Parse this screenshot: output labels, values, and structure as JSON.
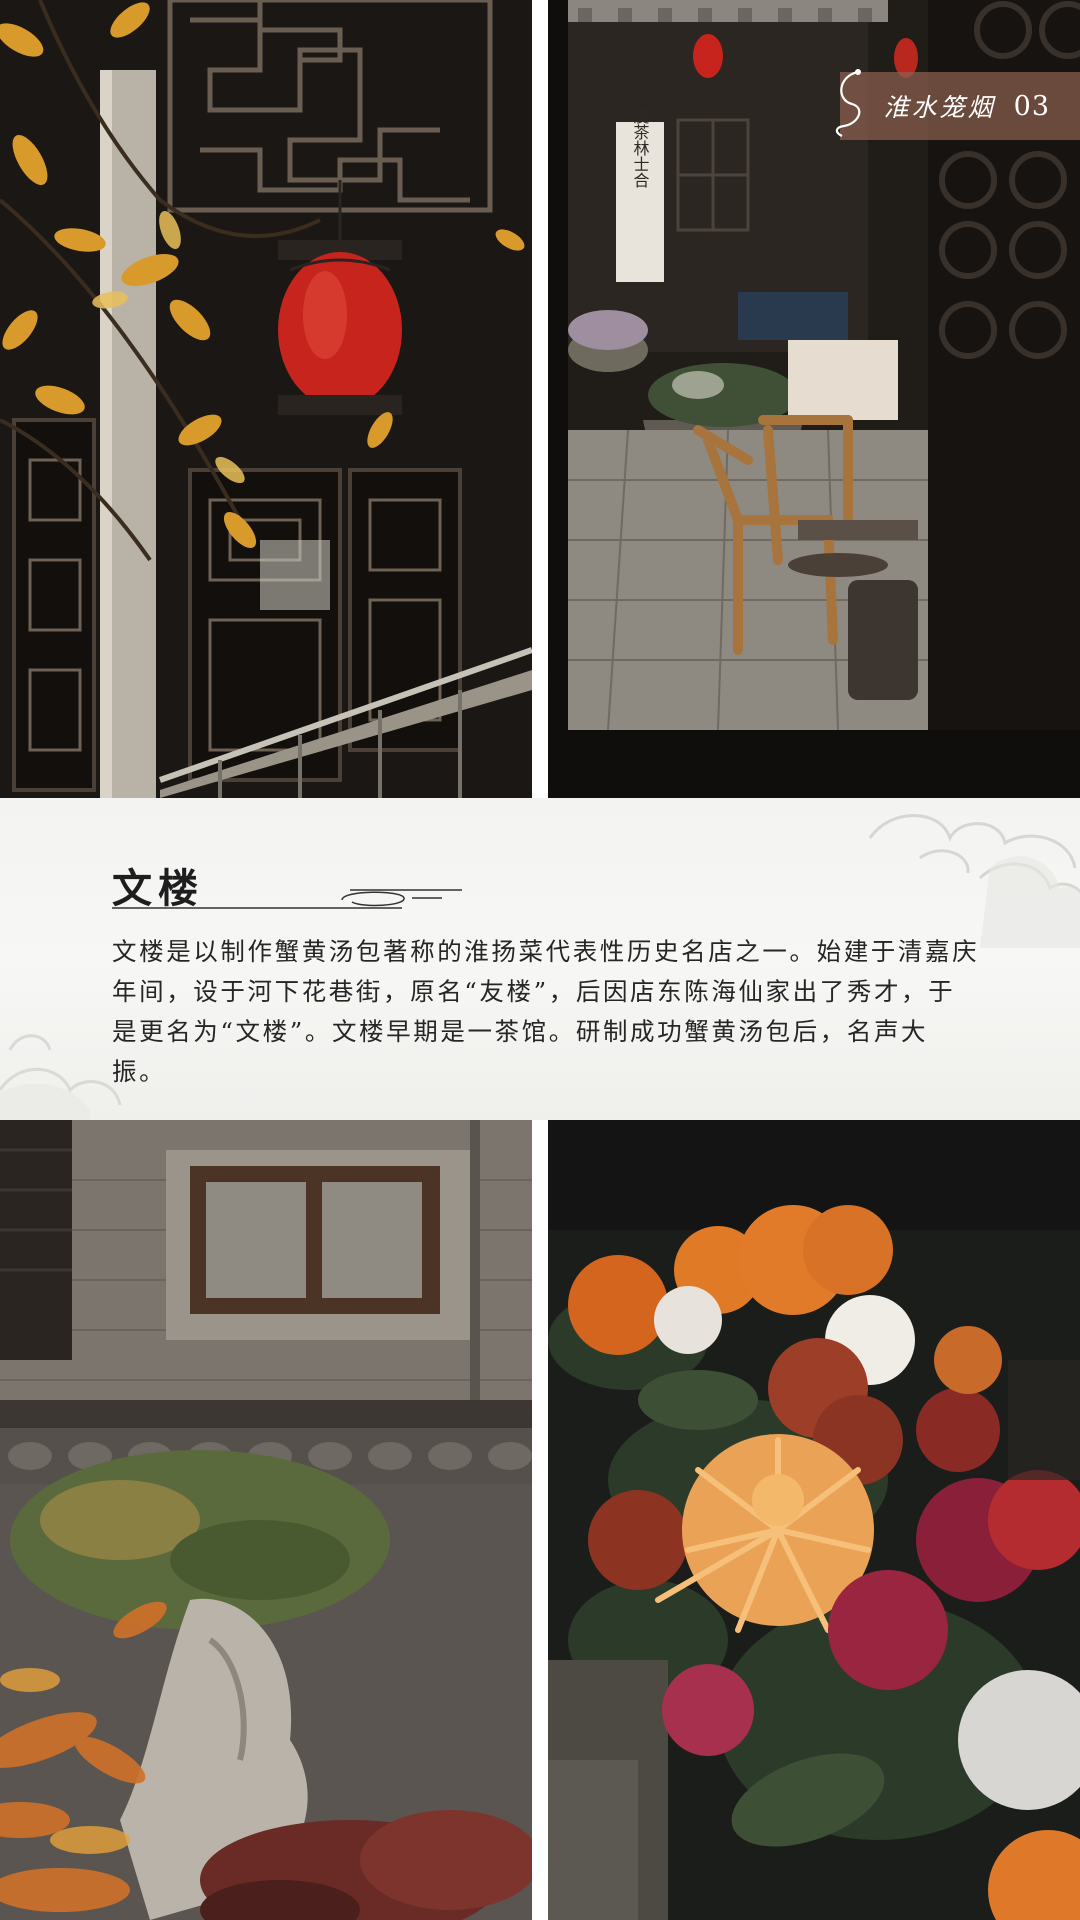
{
  "badge": {
    "name": "淮水笼烟",
    "page_number": "03"
  },
  "section": {
    "title": "文楼",
    "body": "文楼是以制作蟹黄汤包著称的淮扬菜代表性历史名店之一。始建于清嘉庆年间，设于河下花巷街，原名“友楼”，后因店东陈海仙家出了秀才，于是更名为“文楼”。文楼早期是一茶馆。研制成功蟹黄汤包后，名声大振。"
  },
  "photos": {
    "top_left": {
      "signboard_text": ""
    },
    "top_right": {
      "signboard_text": "虞茶林士合"
    }
  },
  "colors": {
    "badge_bg": "#8c5f50",
    "lantern_red": "#c8241e",
    "band_bg": "#f4f4f2",
    "text": "#262626"
  }
}
